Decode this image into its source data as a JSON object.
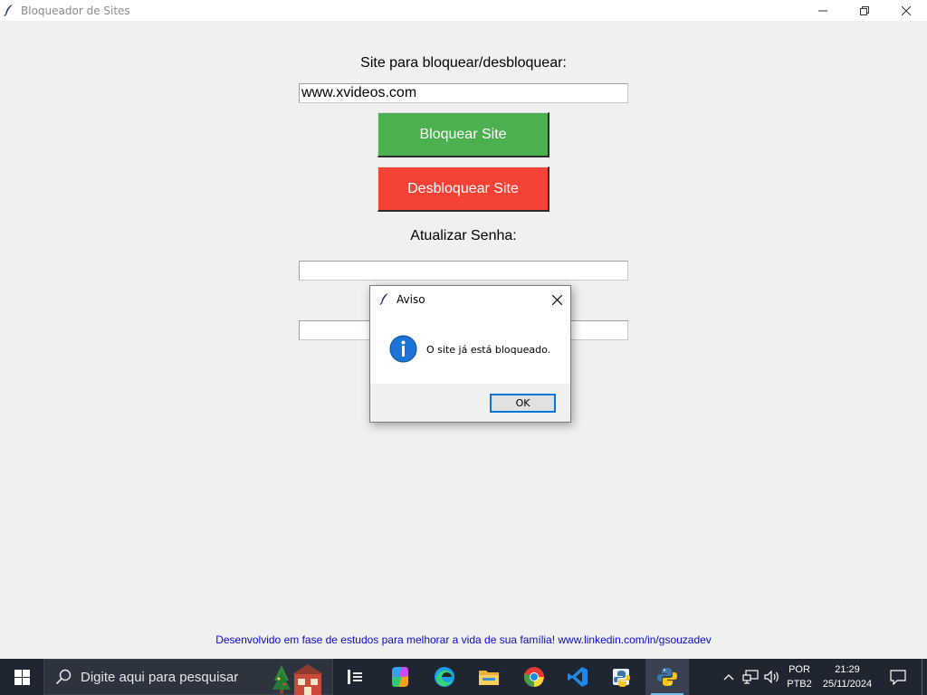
{
  "window": {
    "title": "Bloqueador de Sites"
  },
  "main": {
    "site_label": "Site para bloquear/desbloquear:",
    "site_value": "www.xvideos.com",
    "block_button": "Bloquear Site",
    "unblock_button": "Desbloquear Site",
    "password_label": "Atualizar Senha:",
    "password_value": "",
    "password_confirm_value": "",
    "footer": "Desenvolvido em fase de estudos para melhorar a vida de sua família! www.linkedin.com/in/gsouzadev"
  },
  "dialog": {
    "title": "Aviso",
    "message": "O site já está bloqueado.",
    "ok_button": "OK",
    "icon": "info-icon"
  },
  "taskbar": {
    "search_placeholder": "Digite aqui para pesquisar",
    "apps": [
      "task-view",
      "copilot",
      "edge",
      "file-explorer",
      "chrome",
      "vscode",
      "python-idle",
      "python"
    ],
    "language": "POR",
    "keyboard": "PTB2",
    "time": "21:29",
    "date": "25/11/2024"
  },
  "colors": {
    "block_button": "#4caf50",
    "unblock_button": "#f44336",
    "footer_link": "#0b0bd0",
    "dialog_ok_border": "#0078d7",
    "taskbar": "#1f2631"
  }
}
